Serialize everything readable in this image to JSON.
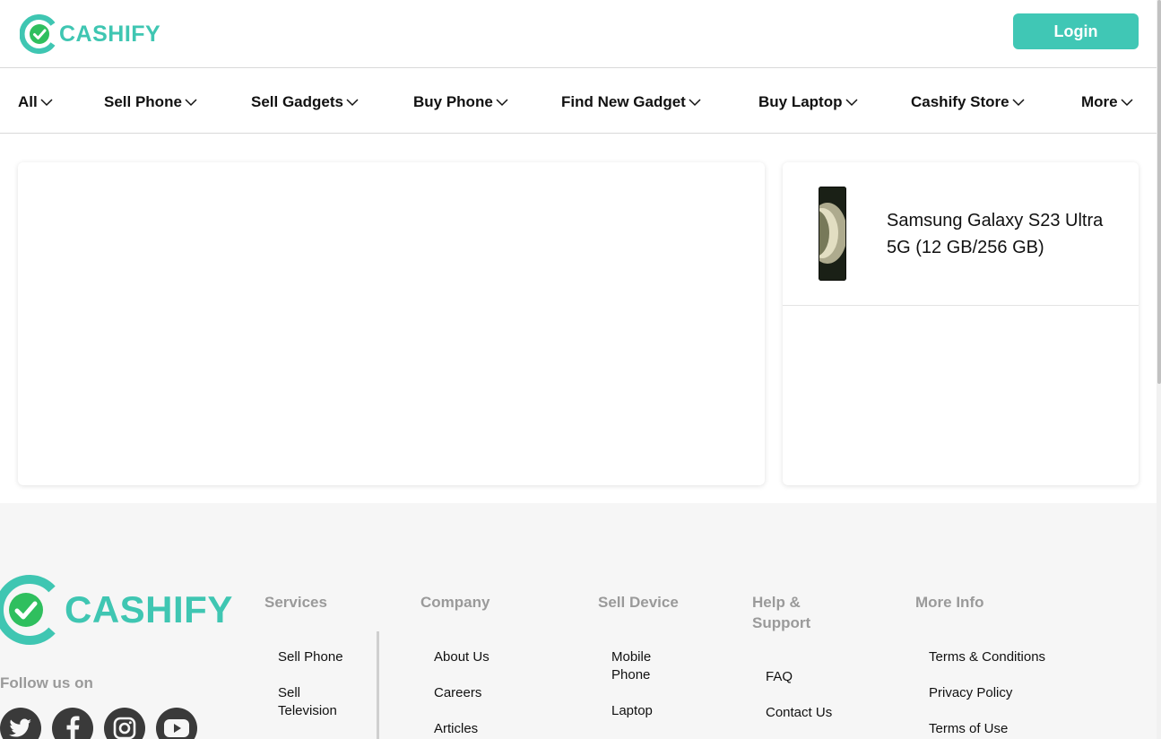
{
  "header": {
    "brand": "CASHIFY",
    "login_label": "Login"
  },
  "nav": {
    "items": [
      {
        "label": "All"
      },
      {
        "label": "Sell Phone"
      },
      {
        "label": "Sell Gadgets"
      },
      {
        "label": "Buy Phone"
      },
      {
        "label": "Find New Gadget"
      },
      {
        "label": "Buy Laptop"
      },
      {
        "label": "Cashify Store"
      },
      {
        "label": "More"
      }
    ]
  },
  "product": {
    "name": "Samsung Galaxy S23 Ultra 5G (12 GB/256 GB)"
  },
  "footer": {
    "brand": "CASHIFY",
    "follow_label": "Follow us on",
    "socials": [
      "twitter-icon",
      "facebook-icon",
      "instagram-icon",
      "youtube-icon"
    ],
    "columns": [
      {
        "title": "Services",
        "links": [
          "Sell Phone",
          "Sell Television"
        ]
      },
      {
        "title": "Company",
        "links": [
          "About Us",
          "Careers",
          "Articles"
        ]
      },
      {
        "title": "Sell Device",
        "links": [
          "Mobile Phone",
          "Laptop"
        ]
      },
      {
        "title": "Help & Support",
        "links": [
          "FAQ",
          "Contact Us"
        ]
      },
      {
        "title": "More Info",
        "links": [
          "Terms & Conditions",
          "Privacy Policy",
          "Terms of Use"
        ]
      }
    ]
  },
  "colors": {
    "brand": "#3fc6b2",
    "login_bg": "#40c7b5",
    "check_green": "#2fbf5e",
    "footer_bg": "#f6f6f6"
  }
}
